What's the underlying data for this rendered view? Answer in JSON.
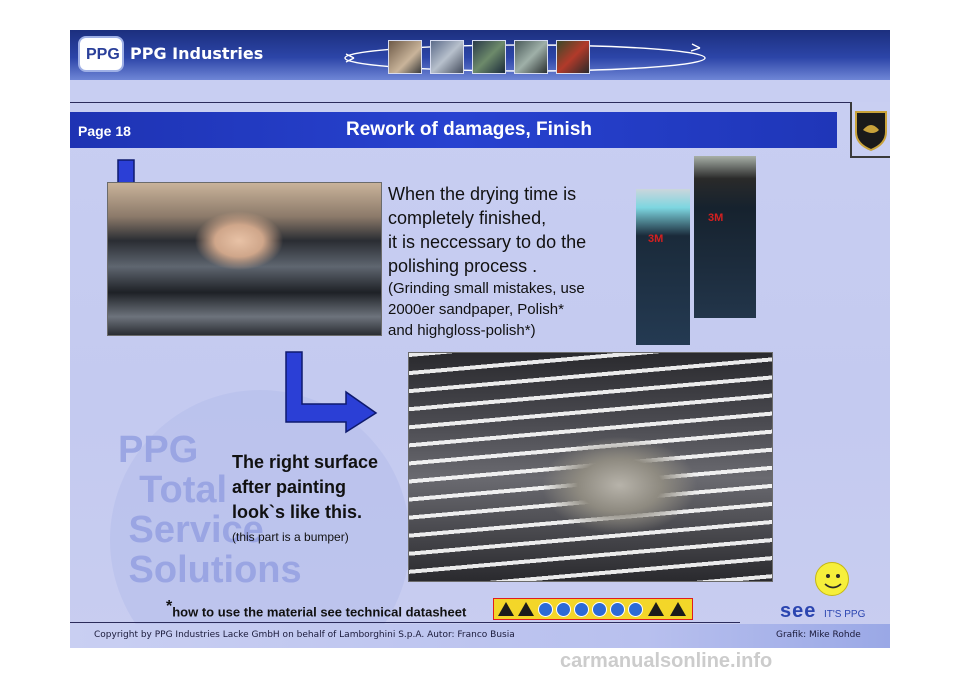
{
  "header": {
    "company_name": "PPG Industries",
    "logo_text": "PPG"
  },
  "title_bar": {
    "page_label": "Page 18",
    "title": "Rework of damages, Finish"
  },
  "content": {
    "main_text_lines": [
      "When the drying time is",
      "completely finished,",
      "it is neccessary to do the",
      "polishing process ."
    ],
    "main_text_detail_lines": [
      "(Grinding small mistakes, use",
      "2000er sandpaper, Polish*",
      "and highgloss-polish*)"
    ],
    "surface_text_lines": [
      "The right surface",
      "after painting",
      "look`s like this."
    ],
    "surface_subtext": "(this part is a bumper)",
    "product_label": "3M"
  },
  "footnote": {
    "asterisk": "*",
    "text": "how to use the material see technical datasheet"
  },
  "branding": {
    "see_text": "see",
    "tagline": "IT'S PPG"
  },
  "footer": {
    "copyright": "Copyright by PPG Industries Lacke GmbH on behalf of Lamborghini S.p.A. Autor: Franco Busia",
    "grafik": "Grafik: Mike Rohde"
  },
  "site_watermark": "carmanualsonline.info",
  "colors": {
    "title_bar": "#2742d0",
    "slide_bg": "#c9cff2",
    "arrow_blue": "#2b3fd6",
    "hazard_yellow": "#f3d629",
    "hazard_border": "#e01d1d"
  },
  "icons": [
    "down-arrow-icon",
    "l-turn-arrow-icon",
    "smiley-icon",
    "hazard-icon",
    "lamborghini-bull-icon"
  ]
}
